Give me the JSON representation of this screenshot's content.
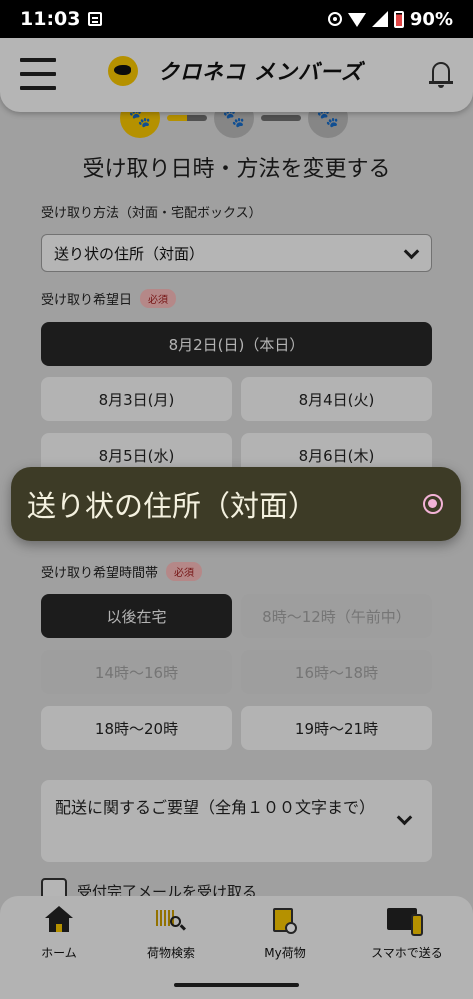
{
  "status_bar": {
    "time": "11:03",
    "battery": "90%"
  },
  "header": {
    "logo_text": "クロネコ メンバーズ"
  },
  "steps": {
    "step1_icon": "🐾",
    "step2_icon": "🐾",
    "step3_icon": "🐾"
  },
  "page_title": "受け取り日時・方法を変更する",
  "method": {
    "label": "受け取り方法（対面・宅配ボックス）",
    "value": "送り状の住所（対面）"
  },
  "date": {
    "label": "受け取り希望日",
    "required": "必須",
    "options": [
      "8月2日(日)（本日）",
      "8月3日(月)",
      "8月4日(火)",
      "8月5日(水)",
      "8月6日(木)"
    ]
  },
  "time": {
    "label": "受け取り希望時間帯",
    "required": "必須",
    "options": [
      "以後在宅",
      "8時～12時（午前中）",
      "14時～16時",
      "16時～18時",
      "18時～20時",
      "19時～21時"
    ]
  },
  "request": {
    "text": "配送に関するご要望（全角１００文字まで）"
  },
  "checkbox": {
    "label": "受付完了メールを受け取る"
  },
  "bottom_nav": {
    "items": [
      {
        "label": "ホーム",
        "icon": "home-icon"
      },
      {
        "label": "荷物検索",
        "icon": "parcel-search-icon"
      },
      {
        "label": "My荷物",
        "icon": "my-parcel-icon"
      },
      {
        "label": "スマホで送る",
        "icon": "smartphone-send-icon"
      }
    ]
  },
  "toast": {
    "text": "送り状の住所（対面）"
  },
  "colors": {
    "brand_yellow": "#f5c400",
    "selected_dark": "#262626",
    "required_pink": "#f5b8b8"
  }
}
